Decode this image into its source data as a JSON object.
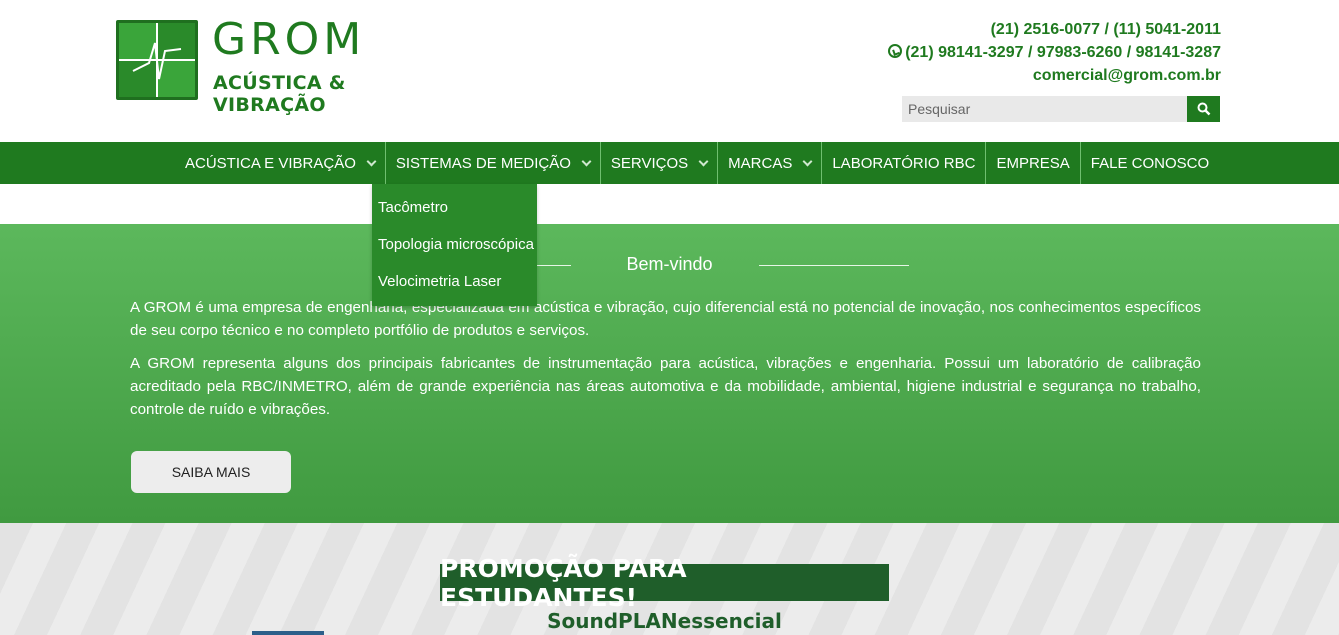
{
  "brand": {
    "name": "GROM",
    "tagline": "ACÚSTICA & VIBRAÇÃO"
  },
  "contact": {
    "phones": "(21) 2516-0077 / (11) 5041-2011",
    "whatsapp": "(21) 98141-3297 / 97983-6260 / 98141-3287",
    "email": "comercial@grom.com.br"
  },
  "search": {
    "placeholder": "Pesquisar",
    "icon": "search-icon"
  },
  "nav": {
    "items": [
      {
        "label": "ACÚSTICA E VIBRAÇÃO"
      },
      {
        "label": "SISTEMAS DE MEDIÇÃO"
      },
      {
        "label": "SERVIÇOS"
      },
      {
        "label": "MARCAS"
      },
      {
        "label": "LABORATÓRIO RBC"
      },
      {
        "label": "EMPRESA"
      },
      {
        "label": "FALE CONOSCO"
      }
    ],
    "dropdown": [
      "Tacômetro",
      "Topologia microscópica",
      "Velocimetria Laser"
    ]
  },
  "welcome": {
    "title": "Bem-vindo",
    "paragraph1": "A GROM é uma empresa de engenharia, especializada em acústica e vibração, cujo diferencial está no potencial de inovação, nos conhecimentos específicos de seu corpo técnico e no completo portfólio de produtos e serviços.",
    "paragraph2": "A GROM representa alguns dos principais fabricantes de instrumentação para acústica, vibrações e engenharia. Possui um laboratório de calibração acreditado pela RBC/INMETRO, além de grande experiência nas áreas automotiva e da mobilidade, ambiental, higiene industrial e segurança no trabalho, controle de ruído e vibrações.",
    "button": "SAIBA MAIS"
  },
  "promo": {
    "title": "PROMOÇÃO PARA ESTUDANTES!",
    "subtitle": "SoundPLANessencial"
  },
  "colors": {
    "primary": "#1f7a1f",
    "welcome_top": "#5cb85c",
    "welcome_bottom": "#409a40",
    "promo_banner": "#1f5e2a"
  }
}
